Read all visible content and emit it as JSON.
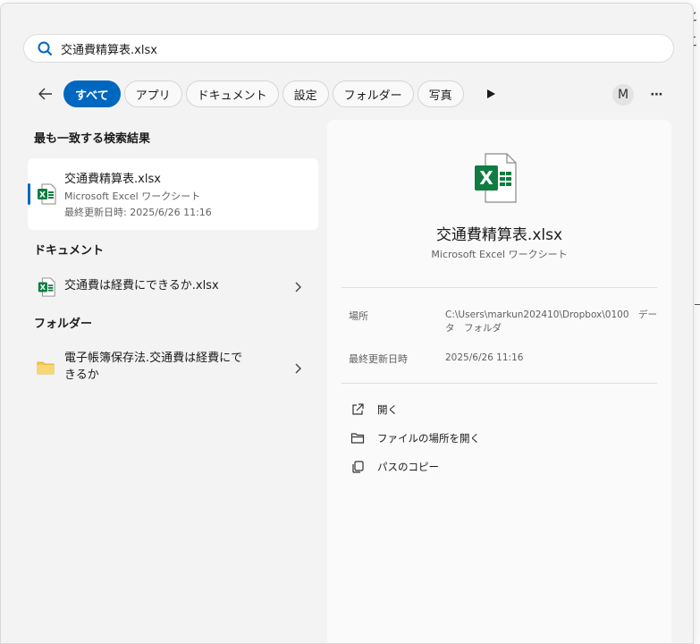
{
  "search": {
    "query": "交通費精算表.xlsx"
  },
  "filters": {
    "back_label": "",
    "chips": [
      "すべて",
      "アプリ",
      "ドキュメント",
      "設定",
      "フォルダー",
      "写真"
    ],
    "avatar": "M",
    "more": "⋯"
  },
  "best_match": {
    "heading": "最も一致する検索結果",
    "name": "交通費精算表.xlsx",
    "type": "Microsoft Excel ワークシート",
    "modified": "最終更新日時: 2025/6/26 11:16"
  },
  "documents": {
    "heading": "ドキュメント",
    "items": [
      {
        "name": "交通費は経費にできるか.xlsx"
      }
    ]
  },
  "folders": {
    "heading": "フォルダー",
    "items": [
      {
        "name_line1": "電子帳簿保存法.交通費は経費にで",
        "name_line2": "きるか"
      }
    ]
  },
  "preview": {
    "title": "交通費精算表.xlsx",
    "subtitle": "Microsoft Excel ワークシート",
    "location_label": "場所",
    "location_value": "C:\\Users\\markun202410\\Dropbox\\0100　データ　フォルダ",
    "modified_label": "最終更新日時",
    "modified_value": "2025/6/26 11:16",
    "actions": [
      "開く",
      "ファイルの場所を開く",
      "パスのコピー"
    ]
  },
  "colors": {
    "accent": "#0067c0",
    "excel_green": "#107c41",
    "folder": "#f2c94c"
  },
  "icons": [
    "search-icon",
    "back-arrow-icon",
    "play-icon",
    "excel-file-icon",
    "folder-icon",
    "chevron-right-icon",
    "open-external-icon",
    "folder-open-icon",
    "copy-icon"
  ]
}
